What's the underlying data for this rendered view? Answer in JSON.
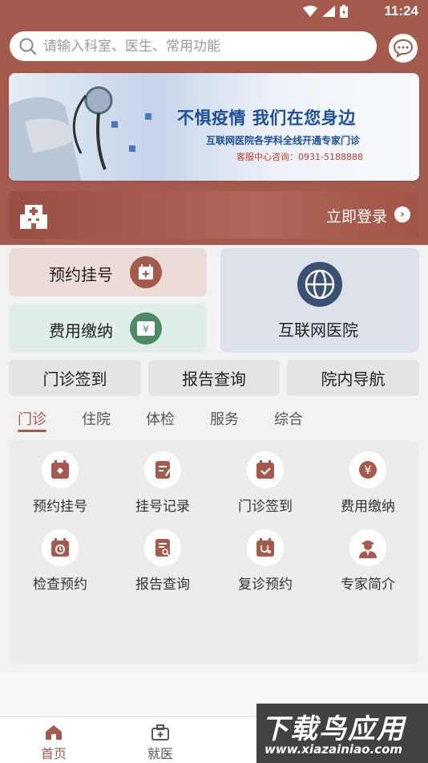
{
  "status": {
    "time": "11:24"
  },
  "search": {
    "placeholder": "请输入科室、医生、常用功能"
  },
  "banner": {
    "title": "不惧疫情 我们在您身边",
    "subtitle": "互联网医院各学科全线开通专家门诊",
    "hotline": "客服中心咨询：0931-5188888"
  },
  "login": {
    "label": "立即登录"
  },
  "cards": {
    "appointment": "预约挂号",
    "fee": "费用缴纳",
    "internet_hospital": "互联网医院"
  },
  "quick": [
    "门诊签到",
    "报告查询",
    "院内导航"
  ],
  "tabs": [
    "门诊",
    "住院",
    "体检",
    "服务",
    "综合"
  ],
  "active_tab": "门诊",
  "grid": [
    {
      "label": "预约挂号",
      "icon": "calendar-plus-icon"
    },
    {
      "label": "挂号记录",
      "icon": "edit-record-icon"
    },
    {
      "label": "门诊签到",
      "icon": "calendar-check-icon"
    },
    {
      "label": "费用缴纳",
      "icon": "yuan-icon"
    },
    {
      "label": "检查预约",
      "icon": "calendar-clock-icon"
    },
    {
      "label": "报告查询",
      "icon": "report-search-icon"
    },
    {
      "label": "复诊预约",
      "icon": "stethoscope-calendar-icon"
    },
    {
      "label": "专家简介",
      "icon": "doctor-icon"
    }
  ],
  "nav": [
    {
      "label": "首页",
      "icon": "home-icon",
      "active": true
    },
    {
      "label": "就医",
      "icon": "medical-kit-icon",
      "active": false
    }
  ],
  "watermark": {
    "title": "下载鸟应用",
    "url": "www.xiazainiao.com"
  },
  "colors": {
    "brand": "#a55a4e",
    "appt_card": "#ecdcd8",
    "fee_card": "#dfeee6",
    "inet_card": "#dce1ea"
  }
}
